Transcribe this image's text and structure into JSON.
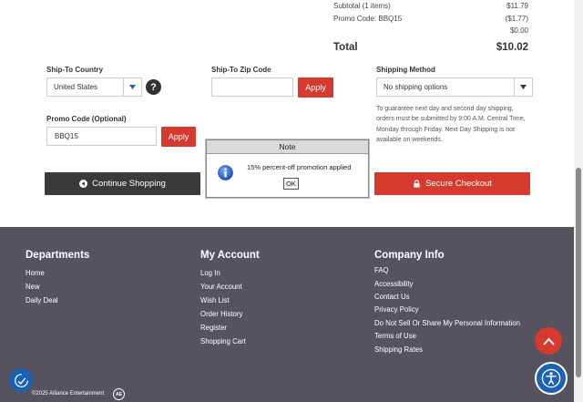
{
  "summary": {
    "subtotal_label": "Subtotal (1 items)",
    "subtotal_value": "$11.79",
    "promo_label": "Promo Code: BBQ15",
    "promo_value": "($1.77)",
    "extra_value": "$0.00",
    "total_label": "Total",
    "total_value": "$10.02"
  },
  "form": {
    "country_label": "Ship-To Country",
    "country_value": "United States",
    "help_glyph": "?",
    "zip_label": "Ship-To Zip Code",
    "zip_value": "",
    "zip_apply": "Apply",
    "shipping_label": "Shipping Method",
    "shipping_value": "No shipping options",
    "shipping_note": "To guarantee next day and second day shipping, orders must be submitted by 9:00 A.M. Central Time, Monday through Friday. Next Day Shipping is not available on weekends.",
    "promo_label": "Promo Code (Optional)",
    "promo_value": "BBQ15",
    "promo_apply": "Apply"
  },
  "buttons": {
    "continue": "Continue Shopping",
    "checkout": "Secure Checkout",
    "continue_color": "#3a3a3a",
    "checkout_color": "#d63a2f"
  },
  "dialog": {
    "title": "Note",
    "message": "15% percent-off promotion applied",
    "ok": "OK",
    "icon": "info-icon"
  },
  "footer": {
    "background": "#56535f",
    "departments": {
      "heading": "Departments",
      "links": [
        "Home",
        "New",
        "Daily Deal"
      ]
    },
    "account": {
      "heading": "My Account",
      "links": [
        "Log In",
        "Your Account",
        "Wish List",
        "Order History",
        "Register",
        "Shopping Cart"
      ]
    },
    "company": {
      "heading": "Company Info",
      "links": [
        "FAQ",
        "Accessibility",
        "Contact Us",
        "Privacy Policy",
        "Do Not Sell Or Share My Personal Information",
        "Terms of Use",
        "Shipping Rates"
      ]
    },
    "copyright": "©2025 Alliance Entertainment",
    "logo_text": "AE"
  }
}
